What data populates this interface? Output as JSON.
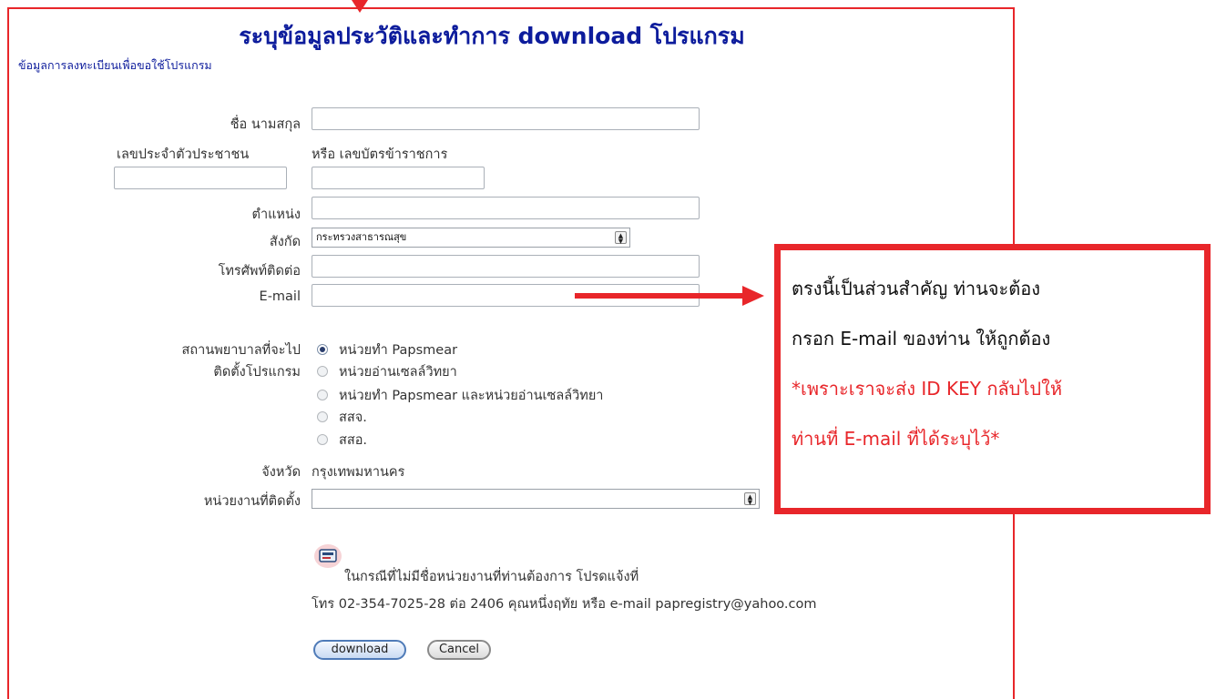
{
  "page": {
    "title": "ระบุข้อมูลประวัติและทำการ download โปรแกรม",
    "subtitle": "ข้อมูลการลงทะเบียนเพื่อขอใช้โปรแกรม"
  },
  "form": {
    "name_label": "ชื่อ นามสกุล",
    "citizen_id_label": "เลขประจำตัวประชาชน",
    "gov_id_label": "หรือ เลขบัตรข้าราชการ",
    "position_label": "ตำแหน่ง",
    "affiliation_label": "สังกัด",
    "affiliation_value": "กระทรวงสาธารณสุข",
    "phone_label": "โทรศัพท์ติดต่อ",
    "email_label": "E-mail",
    "hospital_label_1": "สถานพยาบาลที่จะไป",
    "hospital_label_2": "ติดตั้งโปรแกรม",
    "hospital_options": [
      "หน่วยทำ Papsmear",
      "หน่วยอ่านเซลล์วิทยา",
      "หน่วยทำ Papsmear และหน่วยอ่านเซลล์วิทยา",
      "สสจ.",
      "สสอ."
    ],
    "province_label": "จังหวัด",
    "province_value": "กรุงเทพมหานคร",
    "unit_label": "หน่วยงานที่ติดตั้ง",
    "unit_value": ""
  },
  "notice": {
    "line1": "ในกรณีที่ไม่มีชื่อหน่วยงานที่ท่านต้องการ โปรดแจ้งที่",
    "line2": "โทร 02-354-7025-28 ต่อ 2406 คุณหนึ่งฤทัย หรือ e-mail papregistry@yahoo.com"
  },
  "buttons": {
    "download": "download",
    "cancel": "Cancel"
  },
  "callout": {
    "line1": "ตรงนี้เป็นส่วนสำคัญ ท่านจะต้อง",
    "line2": "กรอก E-mail ของท่าน ให้ถูกต้อง",
    "line3": "*เพราะเราจะส่ง ID KEY กลับไปให้",
    "line4": "ท่านที่ E-mail ที่ได้ระบุไว้*"
  },
  "colors": {
    "annotation_red": "#e8262a",
    "title_blue": "#0d1c9c"
  },
  "icons": {
    "notice": "contact-card-icon",
    "selected_radio": "hospital-option-1"
  }
}
